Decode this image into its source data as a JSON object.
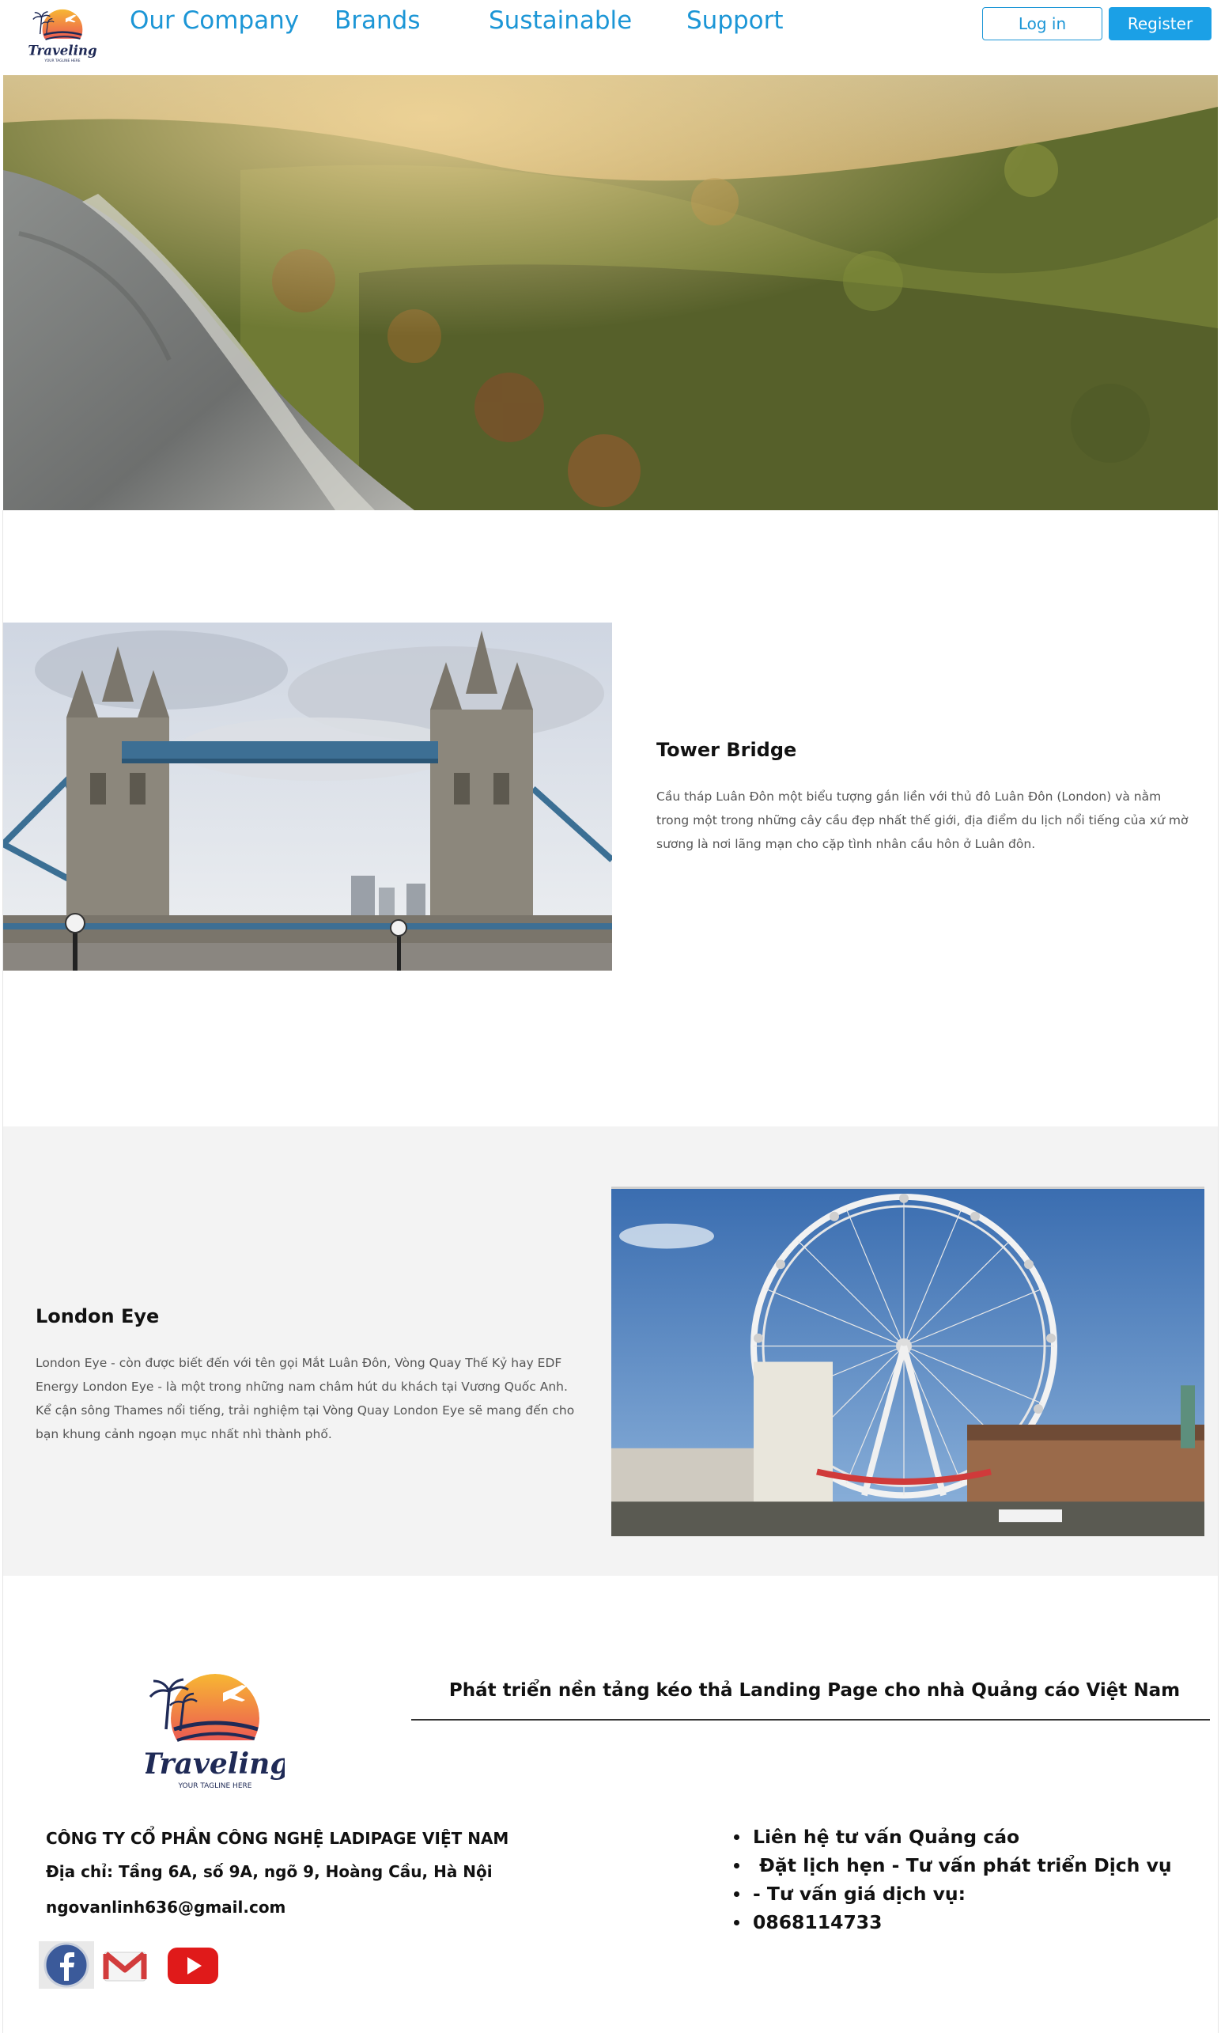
{
  "header": {
    "nav": [
      {
        "label": "Our Company"
      },
      {
        "label": "Brands"
      },
      {
        "label": "Sustainable"
      },
      {
        "label": "Support"
      }
    ],
    "login_label": "Log in",
    "register_label": "Register"
  },
  "logo": {
    "wordmark": "Traveling",
    "tagline": "YOUR TAGLINE HERE"
  },
  "sections": {
    "tower_bridge": {
      "title": "Tower Bridge",
      "lines": [
        "Cầu tháp Luân Đôn một biểu tượng gắn liền với thủ đô Luân Đôn (London) và nằm",
        "trong một trong những cây cầu đẹp nhất thế giới, địa điểm du lịch nổi tiếng của xứ mờ",
        "sương là nơi lãng mạn cho cặp tình nhân cầu hôn ở Luân đôn."
      ]
    },
    "london_eye": {
      "title": "London Eye",
      "lines": [
        "London Eye - còn được biết đến với tên gọi Mắt Luân Đôn, Vòng Quay Thế Kỷ hay EDF",
        "Energy London Eye - là một trong những nam châm hút du khách tại Vương Quốc Anh.",
        "Kể cận sông Thames nổi tiếng, trải nghiệm tại Vòng Quay London Eye sẽ mang đến cho",
        "bạn khung cảnh ngoạn mục nhất nhì thành phố."
      ]
    }
  },
  "footer": {
    "heading": "Phát triển nền tảng kéo thả Landing Page cho nhà Quảng cáo Việt Nam",
    "company": "CÔNG TY CỔ PHẦN CÔNG NGHỆ LADIPAGE VIỆT NAM",
    "address": "Địa chỉ: Tầng 6A, số 9A, ngõ 9, Hoàng Cầu, Hà Nội",
    "email": "ngovanlinh636@gmail.com",
    "contact_items": [
      "Liên hệ tư vấn Quảng cáo",
      " Đặt lịch hẹn - Tư vấn phát triển Dịch vụ",
      "- Tư vấn giá dịch vụ:",
      "0868114733"
    ],
    "social_icons": [
      "facebook-icon",
      "gmail-icon",
      "youtube-icon"
    ]
  },
  "colors": {
    "nav": "#1c96d6",
    "register_bg": "#1ba0e6",
    "section_gray": "#f3f3f3",
    "logo_sun_top": "#f6a623",
    "logo_sun_bottom": "#e8455a",
    "logo_navy": "#1f2a56"
  }
}
